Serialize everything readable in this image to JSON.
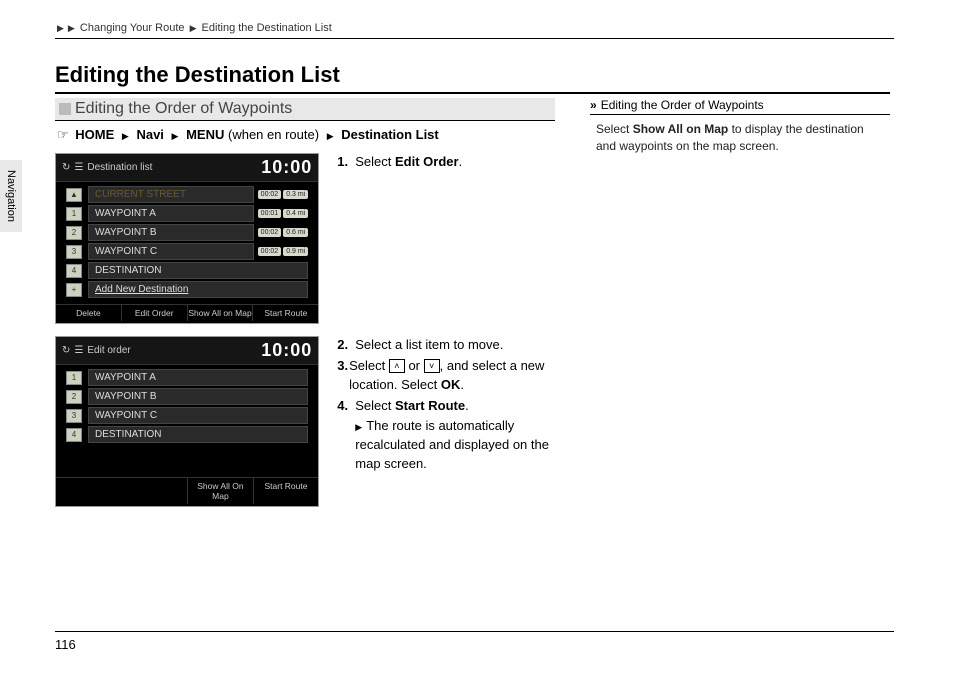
{
  "breadcrumb": {
    "section": "Changing Your Route",
    "page": "Editing the Destination List"
  },
  "page_title": "Editing the Destination List",
  "side_tab": "Navigation",
  "subheading": "Editing the Order of Waypoints",
  "path": {
    "home": "HOME",
    "navi": "Navi",
    "menu": "MENU",
    "paren": "(when en route)",
    "dest": "Destination List"
  },
  "screen1": {
    "title": "Destination list",
    "clock": "10:00",
    "row0": "CURRENT STREET",
    "rows": [
      {
        "n": "1",
        "t": "WAYPOINT A",
        "time": "00:02",
        "dist": "0.3 mi"
      },
      {
        "n": "2",
        "t": "WAYPOINT B",
        "time": "00:01",
        "dist": "0.4 mi"
      },
      {
        "n": "3",
        "t": "WAYPOINT C",
        "time": "00:02",
        "dist": "0.6 mi"
      },
      {
        "n": "4",
        "t": "DESTINATION",
        "time": "00:02",
        "dist": "0.9 mi"
      }
    ],
    "add": "Add New Destination",
    "btns": [
      "Delete",
      "Edit Order",
      "Show All on Map",
      "Start Route"
    ]
  },
  "screen2": {
    "title": "Edit order",
    "clock": "10:00",
    "rows": [
      {
        "n": "1",
        "t": "WAYPOINT A"
      },
      {
        "n": "2",
        "t": "WAYPOINT B"
      },
      {
        "n": "3",
        "t": "WAYPOINT C"
      },
      {
        "n": "4",
        "t": "DESTINATION"
      }
    ],
    "btns": [
      "Show All On Map",
      "Start Route"
    ]
  },
  "instr1": {
    "s1n": "1.",
    "s1a": "Select ",
    "s1b": "Edit Order",
    "s1c": "."
  },
  "instr2": {
    "s2n": "2.",
    "s2": "Select a list item to move.",
    "s3n": "3.",
    "s3a": "Select ",
    "s3b": " or ",
    "s3c": ", and select a new location. Select ",
    "s3ok": "OK",
    "s3d": ".",
    "s4n": "4.",
    "s4a": "Select ",
    "s4b": "Start Route",
    "s4c": ".",
    "note": "The route is automatically recalculated and displayed on the map screen."
  },
  "right": {
    "head": "Editing the Order of Waypoints",
    "b1": "Select ",
    "b2": "Show All on Map",
    "b3": " to display the destination and waypoints on the map screen."
  },
  "page_number": "116",
  "icons": {
    "up": "˄",
    "down": "˅"
  }
}
